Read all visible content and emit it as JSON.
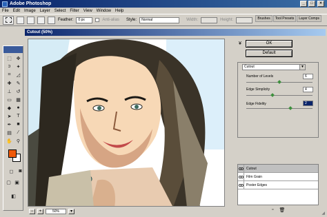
{
  "app": {
    "title": "Adobe Photoshop"
  },
  "menu": [
    "File",
    "Edit",
    "Image",
    "Layer",
    "Select",
    "Filter",
    "View",
    "Window",
    "Help"
  ],
  "options_bar": {
    "feather_label": "Feather:",
    "feather_value": "0 px",
    "antialias_label": "Anti-alias",
    "style_label": "Style:",
    "style_value": "Normal",
    "width_label": "Width:",
    "height_label": "Height:"
  },
  "palette_well": [
    "Brushes",
    "Tool Presets",
    "Layer Comps"
  ],
  "dialog": {
    "title": "Cutout (50%)",
    "ok": "OK",
    "default": "Default",
    "zoom": "50%",
    "filter": "Cutout",
    "params": [
      {
        "label": "Number of Levels",
        "value": "6",
        "fraction": 0.5
      },
      {
        "label": "Edge Simplicity",
        "value": "4",
        "fraction": 0.4
      },
      {
        "label": "Edge Fidelity",
        "value": "2",
        "fraction": 0.67
      }
    ],
    "layers": [
      "Cutout",
      "Film Grain",
      "Poster Edges"
    ]
  },
  "colors": {
    "foreground": "#f05a0a",
    "background": "#ffffff",
    "title_bar": "#0a246a"
  }
}
